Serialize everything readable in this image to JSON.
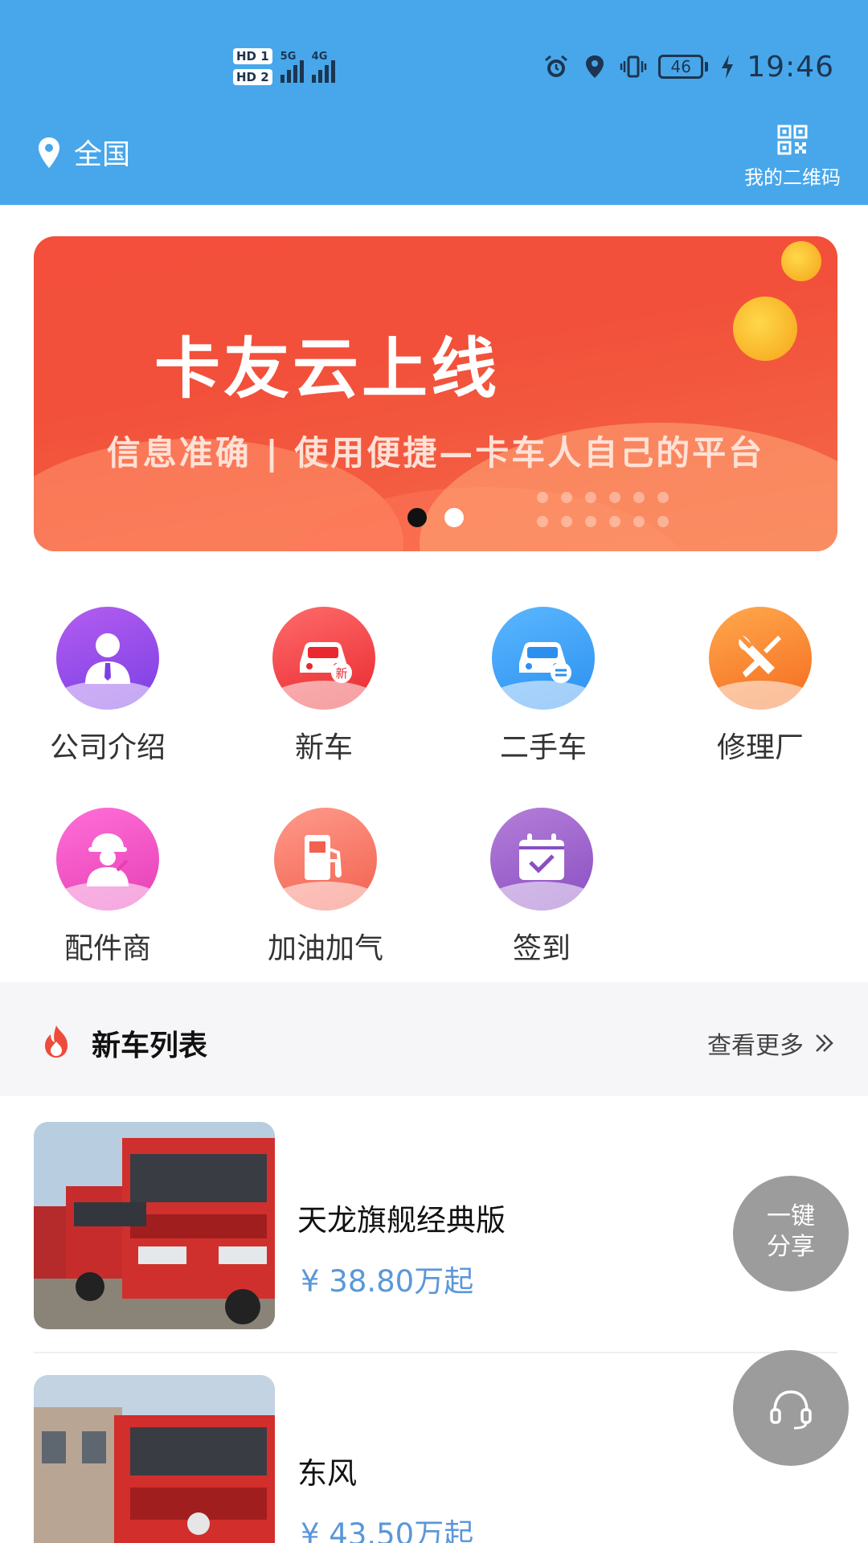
{
  "status_bar": {
    "sim1": "HD 1",
    "sim2": "HD 2",
    "net1": "5G",
    "net2": "4G",
    "battery": "46",
    "time": "19:46"
  },
  "header": {
    "location": "全国",
    "qr_label": "我的二维码"
  },
  "banner": {
    "title": "卡友云上线",
    "subtitle": "信息准确 | 使用便捷—卡车人自己的平台",
    "page_count": 2,
    "active_page": 1
  },
  "grid": {
    "items": [
      {
        "label": "公司介绍",
        "icon": "person-icon"
      },
      {
        "label": "新车",
        "icon": "new-car-icon"
      },
      {
        "label": "二手车",
        "icon": "used-car-icon"
      },
      {
        "label": "修理厂",
        "icon": "repair-tools-icon"
      },
      {
        "label": "配件商",
        "icon": "worker-icon"
      },
      {
        "label": "加油加气",
        "icon": "fuel-pump-icon"
      },
      {
        "label": "签到",
        "icon": "calendar-check-icon"
      }
    ]
  },
  "section": {
    "title": "新车列表",
    "more": "查看更多"
  },
  "trucks": [
    {
      "name": "天龙旗舰经典版",
      "price": "¥  38.80万起"
    },
    {
      "name": "东风",
      "price": "¥  43.50万起"
    }
  ],
  "fab": {
    "share_line1": "一键",
    "share_line2": "分享"
  },
  "colors": {
    "header": "#47a7ea",
    "banner": "#f34f3c",
    "price": "#5b97d8"
  }
}
